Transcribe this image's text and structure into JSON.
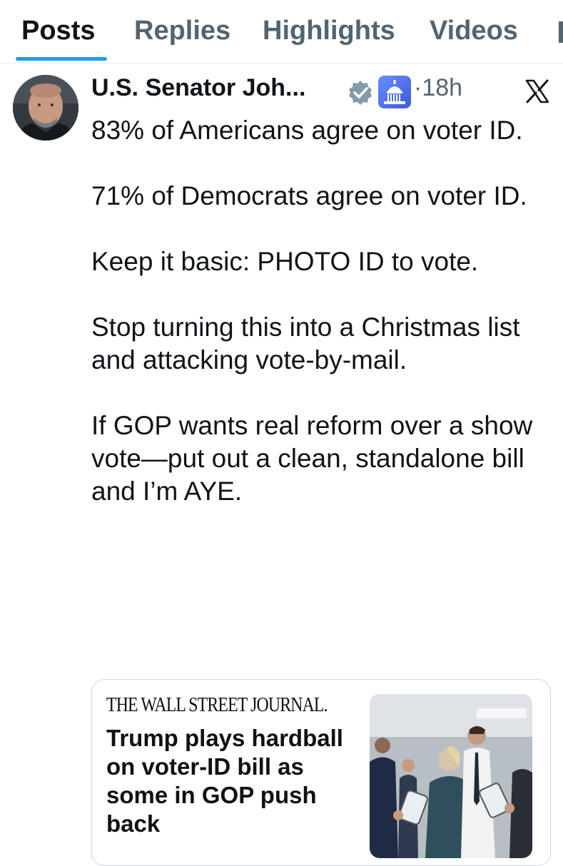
{
  "tabs": [
    {
      "label": "Posts",
      "active": true
    },
    {
      "label": "Replies",
      "active": false
    },
    {
      "label": "Highlights",
      "active": false
    },
    {
      "label": "Videos",
      "active": false
    }
  ],
  "post": {
    "author_name": "U.S. Senator Joh...",
    "dot": "·",
    "time": "18h",
    "icons": [
      "verified-badge-icon",
      "capitol-badge-icon",
      "x-logo-icon"
    ],
    "paragraphs": [
      "83% of Americans agree on voter ID.",
      "71% of Democrats agree on voter ID.",
      "Keep it basic: PHOTO ID to vote.",
      "Stop turning this into a Christmas list and attacking vote-by-mail.",
      "If GOP wants real reform over a show vote—put out a clean, standalone bill and I’m AYE."
    ]
  },
  "card": {
    "source": "THE WALL STREET JOURNAL.",
    "headline": "Trump plays hardball on voter-ID bill as some in GOP push back"
  },
  "colors": {
    "accent": "#1d9bf0",
    "text": "#0f1419",
    "muted": "#536471",
    "border": "#cfd9de"
  }
}
